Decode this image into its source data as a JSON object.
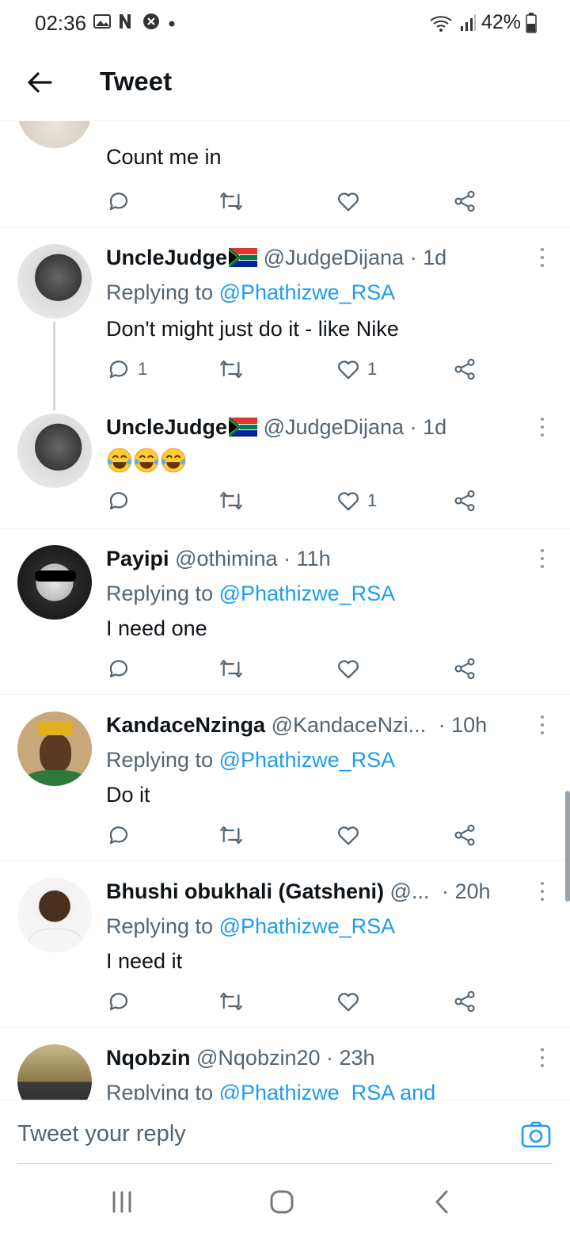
{
  "status": {
    "time": "02:36",
    "battery": "42%"
  },
  "header": {
    "title": "Tweet"
  },
  "tweets": [
    {
      "text": "Count me in"
    },
    {
      "name": "UncleJudge",
      "handle": "@JudgeDijana",
      "time": "· 1d",
      "reply_prefix": "Replying to",
      "reply_to": "@Phathizwe_RSA",
      "text": "Don't might just do it - like Nike",
      "replies": "1",
      "likes": "1"
    },
    {
      "name": "UncleJudge",
      "handle": "@JudgeDijana",
      "time": "· 1d",
      "text": "😂😂😂",
      "likes": "1"
    },
    {
      "name": "Payipi",
      "handle": "@othimina",
      "time": "· 11h",
      "reply_prefix": "Replying to",
      "reply_to": "@Phathizwe_RSA",
      "text": "I need one"
    },
    {
      "name": "KandaceNzinga",
      "handle": "@KandaceNzi...",
      "time": "· 10h",
      "reply_prefix": "Replying to",
      "reply_to": "@Phathizwe_RSA",
      "text": "Do it"
    },
    {
      "name": "Bhushi obukhali (Gatsheni)",
      "handle": "@...",
      "time": "· 20h",
      "reply_prefix": "Replying to",
      "reply_to": "@Phathizwe_RSA",
      "text": "I need it"
    },
    {
      "name": "Nqobzin",
      "handle": "@Nqobzin20",
      "time": "· 23h",
      "reply_prefix": "Replying to",
      "reply_to": "@Phathizwe_RSA and"
    }
  ],
  "composer": {
    "placeholder": "Tweet your reply"
  },
  "colors": {
    "link": "#1d9bf0",
    "secondary": "#536471",
    "primary_text": "#0f1419"
  }
}
